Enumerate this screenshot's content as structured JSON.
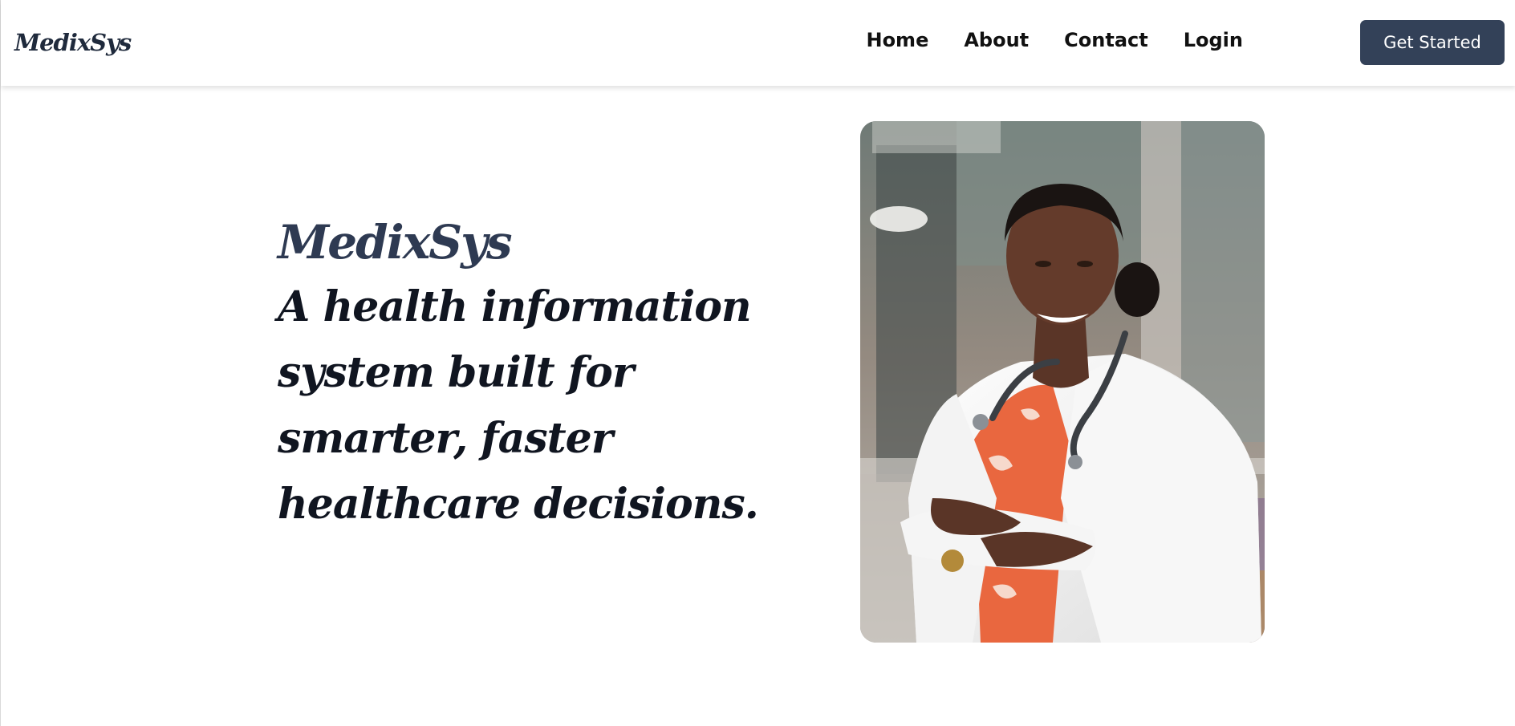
{
  "header": {
    "brand": "MedixSys",
    "nav": [
      {
        "label": "Home"
      },
      {
        "label": "About"
      },
      {
        "label": "Contact"
      },
      {
        "label": "Login"
      }
    ],
    "cta_label": "Get Started"
  },
  "hero": {
    "title": "MedixSys",
    "tagline": "A health information system built for smarter, faster healthcare decisions."
  },
  "colors": {
    "primary": "#334158",
    "heading": "#2e3a52",
    "text": "#101520"
  }
}
